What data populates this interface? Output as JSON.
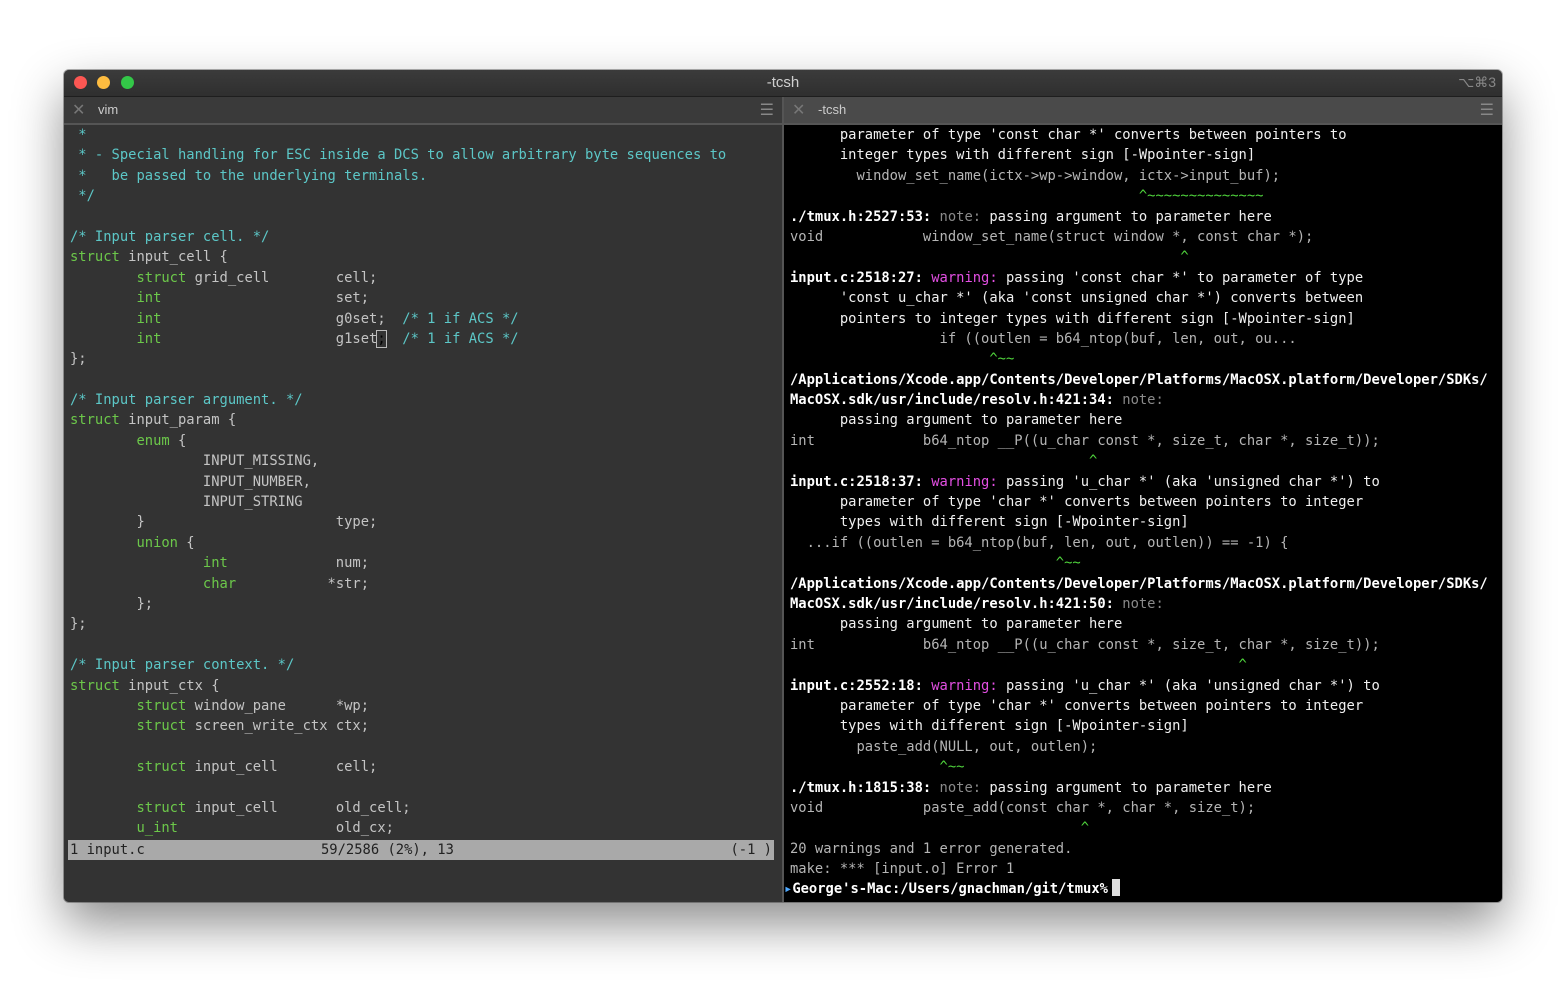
{
  "window": {
    "title": "-tcsh",
    "shortcut": "⌥⌘3",
    "traffic_lights": {
      "close": "#fc5753",
      "minimize": "#fdbc40",
      "zoom": "#33c748"
    }
  },
  "left_tab": {
    "label": "vim",
    "close_icon": "close-icon",
    "menu_icon": "hamburger-icon"
  },
  "right_tab": {
    "label": "-tcsh",
    "close_icon": "close-icon",
    "menu_icon": "hamburger-icon"
  },
  "colors": {
    "comment": "#5cc7c7",
    "keyword": "#6cc84a",
    "warning": "#e34fe3",
    "caret": "#4fd33c",
    "note": "#8a8a8a"
  },
  "vim": {
    "lines": [
      [
        [
          " *",
          "c"
        ]
      ],
      [
        [
          " * - Special handling for ESC inside a DCS to allow arbitrary byte sequences to",
          "c"
        ]
      ],
      [
        [
          " *   be passed to the underlying terminals.",
          "c"
        ]
      ],
      [
        [
          " */",
          "c"
        ]
      ],
      [],
      [
        [
          "/* Input parser cell. */",
          "c"
        ]
      ],
      [
        [
          "struct",
          "k"
        ],
        [
          " input_cell {",
          "n"
        ]
      ],
      [
        [
          "        ",
          "n"
        ],
        [
          "struct",
          "k"
        ],
        [
          " grid_cell        cell;",
          "n"
        ]
      ],
      [
        [
          "        ",
          "n"
        ],
        [
          "int",
          "k"
        ],
        [
          "                     set;",
          "n"
        ]
      ],
      [
        [
          "        ",
          "n"
        ],
        [
          "int",
          "k"
        ],
        [
          "                     g0set;  ",
          "n"
        ],
        [
          "/* 1 if ACS */",
          "c"
        ]
      ],
      [
        [
          "        ",
          "n"
        ],
        [
          "int",
          "k"
        ],
        [
          "                     g1set",
          "n"
        ],
        [
          ";",
          "cur"
        ],
        [
          "  ",
          "n"
        ],
        [
          "/* 1 if ACS */",
          "c"
        ]
      ],
      [
        [
          "};",
          "n"
        ]
      ],
      [],
      [
        [
          "/* Input parser argument. */",
          "c"
        ]
      ],
      [
        [
          "struct",
          "k"
        ],
        [
          " input_param {",
          "n"
        ]
      ],
      [
        [
          "        ",
          "n"
        ],
        [
          "enum",
          "k"
        ],
        [
          " {",
          "n"
        ]
      ],
      [
        [
          "                INPUT_MISSING,",
          "n"
        ]
      ],
      [
        [
          "                INPUT_NUMBER,",
          "n"
        ]
      ],
      [
        [
          "                INPUT_STRING",
          "n"
        ]
      ],
      [
        [
          "        }                       type;",
          "n"
        ]
      ],
      [
        [
          "        ",
          "n"
        ],
        [
          "union",
          "k"
        ],
        [
          " {",
          "n"
        ]
      ],
      [
        [
          "                ",
          "n"
        ],
        [
          "int",
          "k"
        ],
        [
          "             num;",
          "n"
        ]
      ],
      [
        [
          "                ",
          "n"
        ],
        [
          "char",
          "k"
        ],
        [
          "           *str;",
          "n"
        ]
      ],
      [
        [
          "        };",
          "n"
        ]
      ],
      [
        [
          "};",
          "n"
        ]
      ],
      [],
      [
        [
          "/* Input parser context. */",
          "c"
        ]
      ],
      [
        [
          "struct",
          "k"
        ],
        [
          " input_ctx {",
          "n"
        ]
      ],
      [
        [
          "        ",
          "n"
        ],
        [
          "struct",
          "k"
        ],
        [
          " window_pane      *wp;",
          "n"
        ]
      ],
      [
        [
          "        ",
          "n"
        ],
        [
          "struct",
          "k"
        ],
        [
          " screen_write_ctx ctx;",
          "n"
        ]
      ],
      [],
      [
        [
          "        ",
          "n"
        ],
        [
          "struct",
          "k"
        ],
        [
          " input_cell       cell;",
          "n"
        ]
      ],
      [],
      [
        [
          "        ",
          "n"
        ],
        [
          "struct",
          "k"
        ],
        [
          " input_cell       old_cell;",
          "n"
        ]
      ],
      [
        [
          "        ",
          "n"
        ],
        [
          "u_int",
          "k"
        ],
        [
          "                   old_cx;",
          "n"
        ]
      ]
    ],
    "status": {
      "file": "1 input.c",
      "position": "59/2586 (2%), 13",
      "right": "(-1 )"
    }
  },
  "terminal": {
    "lines": [
      [
        [
          "      parameter of type 'const char *' converts between pointers to",
          "w"
        ]
      ],
      [
        [
          "      integer types with different sign [-Wpointer-sign]",
          "w"
        ]
      ],
      [
        [
          "        window_set_name(ictx->wp->window, ictx->input_buf);",
          "g"
        ]
      ],
      [
        [
          "                                          ^~~~~~~~~~~~~~~",
          "gr"
        ]
      ],
      [
        [
          "./tmux.h:2527:53:",
          "b"
        ],
        [
          " note:",
          "nt"
        ],
        [
          " passing argument to parameter here",
          "w"
        ]
      ],
      [
        [
          "void            window_set_name(struct window *, const char *);",
          "g"
        ]
      ],
      [
        [
          "                                               ^",
          "gr"
        ]
      ],
      [
        [
          "input.c:2518:27:",
          "b"
        ],
        [
          " warning:",
          "wm"
        ],
        [
          " passing 'const char *' to parameter of type",
          "w"
        ]
      ],
      [
        [
          "      'const u_char *' (aka 'const unsigned char *') converts between",
          "w"
        ]
      ],
      [
        [
          "      pointers to integer types with different sign [-Wpointer-sign]",
          "w"
        ]
      ],
      [
        [
          "                  if ((outlen = b64_ntop(buf, len, out, ou...",
          "g"
        ]
      ],
      [
        [
          "                        ^~~",
          "gr"
        ]
      ],
      [
        [
          "/Applications/Xcode.app/Contents/Developer/Platforms/MacOSX.platform/Developer/SDKs/",
          "b"
        ]
      ],
      [
        [
          "MacOSX.sdk/usr/include/resolv.h:421:34:",
          "b"
        ],
        [
          " note:",
          "nt"
        ]
      ],
      [
        [
          "      passing argument to parameter here",
          "w"
        ]
      ],
      [
        [
          "int             b64_ntop __P((u_char const *, size_t, char *, size_t));",
          "g"
        ]
      ],
      [
        [
          "                                    ^",
          "gr"
        ]
      ],
      [
        [
          "input.c:2518:37:",
          "b"
        ],
        [
          " warning:",
          "wm"
        ],
        [
          " passing 'u_char *' (aka 'unsigned char *') to",
          "w"
        ]
      ],
      [
        [
          "      parameter of type 'char *' converts between pointers to integer",
          "w"
        ]
      ],
      [
        [
          "      types with different sign [-Wpointer-sign]",
          "w"
        ]
      ],
      [
        [
          "  ...if ((outlen = b64_ntop(buf, len, out, outlen)) == -1) {",
          "g"
        ]
      ],
      [
        [
          "                                ^~~",
          "gr"
        ]
      ],
      [
        [
          "/Applications/Xcode.app/Contents/Developer/Platforms/MacOSX.platform/Developer/SDKs/",
          "b"
        ]
      ],
      [
        [
          "MacOSX.sdk/usr/include/resolv.h:421:50:",
          "b"
        ],
        [
          " note:",
          "nt"
        ]
      ],
      [
        [
          "      passing argument to parameter here",
          "w"
        ]
      ],
      [
        [
          "int             b64_ntop __P((u_char const *, size_t, char *, size_t));",
          "g"
        ]
      ],
      [
        [
          "                                                      ^",
          "gr"
        ]
      ],
      [
        [
          "input.c:2552:18:",
          "b"
        ],
        [
          " warning:",
          "wm"
        ],
        [
          " passing 'u_char *' (aka 'unsigned char *') to",
          "w"
        ]
      ],
      [
        [
          "      parameter of type 'char *' converts between pointers to integer",
          "w"
        ]
      ],
      [
        [
          "      types with different sign [-Wpointer-sign]",
          "w"
        ]
      ],
      [
        [
          "        paste_add(NULL, out, outlen);",
          "g"
        ]
      ],
      [
        [
          "                  ^~~",
          "gr"
        ]
      ],
      [
        [
          "./tmux.h:1815:38:",
          "b"
        ],
        [
          " note:",
          "nt"
        ],
        [
          " passing argument to parameter here",
          "w"
        ]
      ],
      [
        [
          "void            paste_add(const char *, char *, size_t);",
          "g"
        ]
      ],
      [
        [
          "                                   ^",
          "gr"
        ]
      ],
      [
        [
          "20 warnings and 1 error generated.",
          "g"
        ]
      ],
      [
        [
          "make: *** [input.o] Error 1",
          "g"
        ]
      ]
    ],
    "prompt": "George's-Mac:/Users/gnachman/git/tmux%"
  }
}
